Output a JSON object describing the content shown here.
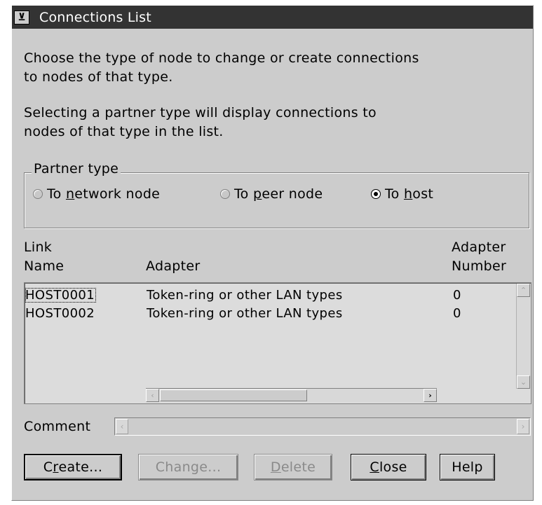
{
  "window": {
    "title": "Connections List",
    "system_menu_glyph": "⊻"
  },
  "description": {
    "line1": "Choose the type of node to change or create connections",
    "line2": "to nodes of that type.",
    "line3": "Selecting a partner type will display connections to",
    "line4": "nodes of that type in the list."
  },
  "partner_type": {
    "label": "Partner type",
    "options": [
      {
        "pre": "To ",
        "mnemonic": "n",
        "post": "etwork node",
        "selected": false
      },
      {
        "pre": "To ",
        "mnemonic": "p",
        "post": "eer node",
        "selected": false
      },
      {
        "pre": "To ",
        "mnemonic": "h",
        "post": "ost",
        "selected": true
      }
    ]
  },
  "list": {
    "headers": {
      "link_name_1": "Link",
      "link_name_2": "Name",
      "adapter": "Adapter",
      "adapter_number_1": "Adapter",
      "adapter_number_2": "Number"
    },
    "rows": [
      {
        "link_name": "HOST0001",
        "adapter": "Token-ring or other LAN types",
        "adapter_number": "0"
      },
      {
        "link_name": "HOST0002",
        "adapter": "Token-ring or other LAN types",
        "adapter_number": "0"
      }
    ]
  },
  "comment": {
    "label": "Comment",
    "value": ""
  },
  "buttons": {
    "create": {
      "pre": "C",
      "mnemonic": "r",
      "post": "eate..."
    },
    "change": {
      "pre": "Change...",
      "mnemonic": "",
      "post": ""
    },
    "delete": {
      "pre": "",
      "mnemonic": "D",
      "post": "elete"
    },
    "close": {
      "pre": "",
      "mnemonic": "C",
      "post": "lose"
    },
    "help": {
      "pre": "Help",
      "mnemonic": "",
      "post": ""
    }
  },
  "colors": {
    "titlebar": "#333333",
    "dialog_bg": "#cccccc",
    "list_bg": "#dcdcdc"
  }
}
